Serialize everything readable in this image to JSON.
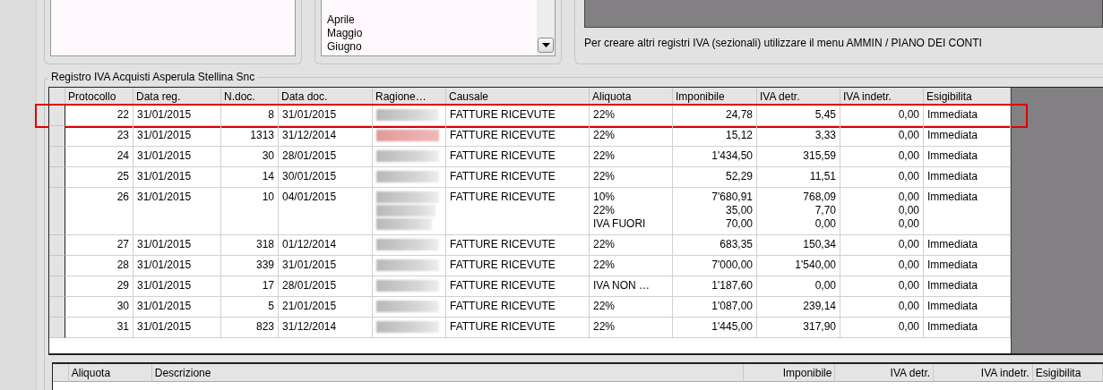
{
  "months_list": {
    "items": [
      "Aprile",
      "Maggio",
      "Giugno"
    ]
  },
  "info_text": "Per creare altri registri IVA (sezionali) utilizzare il menu AMMIN / PIANO DEI CONTI",
  "register": {
    "title": "Registro IVA Acquisti Asperula Stellina Snc",
    "columns": [
      "Protocollo",
      "Data reg.",
      "N.doc.",
      "Data doc.",
      "Ragione…",
      "Causale",
      "Aliquota",
      "Imponibile",
      "IVA detr.",
      "IVA indetr.",
      "Esigibilita"
    ],
    "rows": [
      {
        "protocollo": "22",
        "data_reg": "31/01/2015",
        "n_doc": "8",
        "data_doc": "31/01/2015",
        "causale": "FATTURE RICEVUTE",
        "esigibilita": "Immediata",
        "highlighted": true,
        "lines": [
          {
            "aliquota": "22%",
            "imponibile": "24,78",
            "iva_detr": "5,45",
            "iva_indetr": "0,00"
          }
        ]
      },
      {
        "protocollo": "23",
        "data_reg": "31/01/2015",
        "n_doc": "1313",
        "data_doc": "31/12/2014",
        "causale": "FATTURE RICEVUTE",
        "esigibilita": "Immediata",
        "highlighted": false,
        "lines": [
          {
            "aliquota": "22%",
            "imponibile": "15,12",
            "iva_detr": "3,33",
            "iva_indetr": "0,00"
          }
        ]
      },
      {
        "protocollo": "24",
        "data_reg": "31/01/2015",
        "n_doc": "30",
        "data_doc": "28/01/2015",
        "causale": "FATTURE RICEVUTE",
        "esigibilita": "Immediata",
        "highlighted": false,
        "lines": [
          {
            "aliquota": "22%",
            "imponibile": "1'434,50",
            "iva_detr": "315,59",
            "iva_indetr": "0,00"
          }
        ]
      },
      {
        "protocollo": "25",
        "data_reg": "31/01/2015",
        "n_doc": "14",
        "data_doc": "30/01/2015",
        "causale": "FATTURE RICEVUTE",
        "esigibilita": "Immediata",
        "highlighted": false,
        "lines": [
          {
            "aliquota": "22%",
            "imponibile": "52,29",
            "iva_detr": "11,51",
            "iva_indetr": "0,00"
          }
        ]
      },
      {
        "protocollo": "26",
        "data_reg": "31/01/2015",
        "n_doc": "10",
        "data_doc": "04/01/2015",
        "causale": "FATTURE RICEVUTE",
        "esigibilita": "Immediata",
        "highlighted": false,
        "lines": [
          {
            "aliquota": "10%",
            "imponibile": "7'680,91",
            "iva_detr": "768,09",
            "iva_indetr": "0,00"
          },
          {
            "aliquota": "22%",
            "imponibile": "35,00",
            "iva_detr": "7,70",
            "iva_indetr": "0,00"
          },
          {
            "aliquota": "IVA FUORI",
            "imponibile": "70,00",
            "iva_detr": "0,00",
            "iva_indetr": "0,00"
          }
        ]
      },
      {
        "protocollo": "27",
        "data_reg": "31/01/2015",
        "n_doc": "318",
        "data_doc": "01/12/2014",
        "causale": "FATTURE RICEVUTE",
        "esigibilita": "Immediata",
        "highlighted": false,
        "lines": [
          {
            "aliquota": "22%",
            "imponibile": "683,35",
            "iva_detr": "150,34",
            "iva_indetr": "0,00"
          }
        ]
      },
      {
        "protocollo": "28",
        "data_reg": "31/01/2015",
        "n_doc": "339",
        "data_doc": "31/01/2015",
        "causale": "FATTURE RICEVUTE",
        "esigibilita": "Immediata",
        "highlighted": false,
        "lines": [
          {
            "aliquota": "22%",
            "imponibile": "7'000,00",
            "iva_detr": "1'540,00",
            "iva_indetr": "0,00"
          }
        ]
      },
      {
        "protocollo": "29",
        "data_reg": "31/01/2015",
        "n_doc": "17",
        "data_doc": "28/01/2015",
        "causale": "FATTURE RICEVUTE",
        "esigibilita": "Immediata",
        "highlighted": false,
        "lines": [
          {
            "aliquota": "IVA NON …",
            "imponibile": "1'187,60",
            "iva_detr": "0,00",
            "iva_indetr": "0,00"
          }
        ]
      },
      {
        "protocollo": "30",
        "data_reg": "31/01/2015",
        "n_doc": "5",
        "data_doc": "21/01/2015",
        "causale": "FATTURE RICEVUTE",
        "esigibilita": "Immediata",
        "highlighted": false,
        "lines": [
          {
            "aliquota": "22%",
            "imponibile": "1'087,00",
            "iva_detr": "239,14",
            "iva_indetr": "0,00"
          }
        ]
      },
      {
        "protocollo": "31",
        "data_reg": "31/01/2015",
        "n_doc": "823",
        "data_doc": "31/12/2014",
        "causale": "FATTURE RICEVUTE",
        "esigibilita": "Immediata",
        "highlighted": false,
        "lines": [
          {
            "aliquota": "22%",
            "imponibile": "1'445,00",
            "iva_detr": "317,90",
            "iva_indetr": "0,00"
          }
        ]
      }
    ]
  },
  "detail_table": {
    "columns": [
      "Aliquota",
      "Descrizione",
      "Imponibile",
      "IVA detr.",
      "IVA indetr.",
      "Esigibilita"
    ]
  }
}
